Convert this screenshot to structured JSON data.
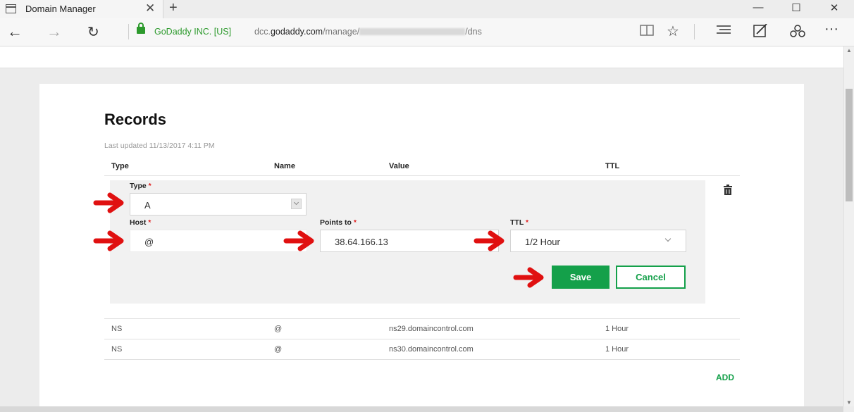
{
  "browser": {
    "tab_title": "Domain Manager",
    "site_identity": "GoDaddy INC. [US]",
    "url_prefix": "dcc.",
    "url_domain": "godaddy.com",
    "url_path": "/manage/",
    "url_suffix": "/dns"
  },
  "records": {
    "title": "Records",
    "last_updated": "Last updated 11/13/2017 4:11 PM",
    "columns": [
      "Type",
      "Name",
      "Value",
      "TTL"
    ]
  },
  "edit_form": {
    "type_label": "Type",
    "type_value": "A",
    "host_label": "Host",
    "host_value": "@",
    "points_to_label": "Points to",
    "points_to_value": "38.64.166.13",
    "ttl_label": "TTL",
    "ttl_value": "1/2 Hour",
    "required_mark": "*",
    "save_label": "Save",
    "cancel_label": "Cancel"
  },
  "rows": [
    {
      "type": "NS",
      "name": "@",
      "value": "ns29.domaincontrol.com",
      "ttl": "1 Hour"
    },
    {
      "type": "NS",
      "name": "@",
      "value": "ns30.domaincontrol.com",
      "ttl": "1 Hour"
    }
  ],
  "add_label": "ADD",
  "colors": {
    "accent_green": "#14a04a",
    "arrow_red": "#e01010",
    "required_red": "#e02020",
    "secure_green": "#2d9a2d"
  }
}
